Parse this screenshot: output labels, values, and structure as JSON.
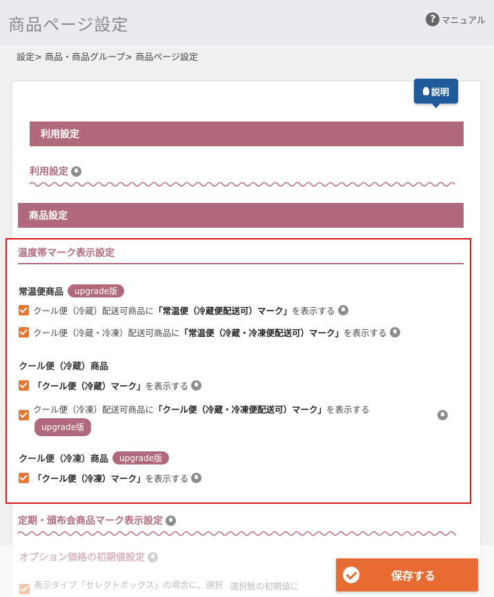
{
  "header": {
    "title": "商品ページ設定",
    "manual_label": "マニュアル"
  },
  "breadcrumb": "設定> 商品・商品グループ> 商品ページ設定",
  "explain_label": "説明",
  "sections": {
    "usage_bar": "利用設定",
    "usage_sub": "利用設定",
    "product_bar": "商品設定"
  },
  "temperature": {
    "title": "温度帯マーク表示設定",
    "upgrade_label": "upgrade版",
    "groups": [
      {
        "label": "常温便商品",
        "options": [
          {
            "pre": "クール便（冷蔵）配送可商品に",
            "bold": "「常温便（冷蔵便配送可）マーク」",
            "post": "を表示する",
            "checked": true
          },
          {
            "pre": "クール便（冷蔵・冷凍）配送可商品に",
            "bold": "「常温便（冷蔵・冷凍便配送可）マーク」",
            "post": "を表示する",
            "checked": true
          }
        ]
      },
      {
        "label": "クール便（冷蔵）商品",
        "options": [
          {
            "pre": "",
            "bold": "「クール便（冷蔵）マーク」",
            "post": "を表示する",
            "checked": true
          },
          {
            "pre": "クール便（冷凍）配送可商品に",
            "bold": "「クール便（冷蔵・冷凍便配送可）マーク」",
            "post": "を表示する",
            "checked": true
          }
        ]
      },
      {
        "label": "クール便（冷凍）商品",
        "options": [
          {
            "pre": "",
            "bold": "「クール便（冷凍）マーク」",
            "post": "を表示する",
            "checked": true
          }
        ]
      }
    ]
  },
  "periodic_heading": "定期・頒布会商品マーク表示設定",
  "option_price_heading": "オプション価格の初期値設定",
  "option_price_text_1": "表示タイプ「セレクトボックス」の場合に、選択",
  "option_price_text_2": "選択肢の初期値に",
  "save_label": "保存する",
  "colors": {
    "accent": "#b06a7c",
    "checkbox": "#e8762f",
    "save": "#e86b33",
    "highlight": "#d9151b"
  }
}
